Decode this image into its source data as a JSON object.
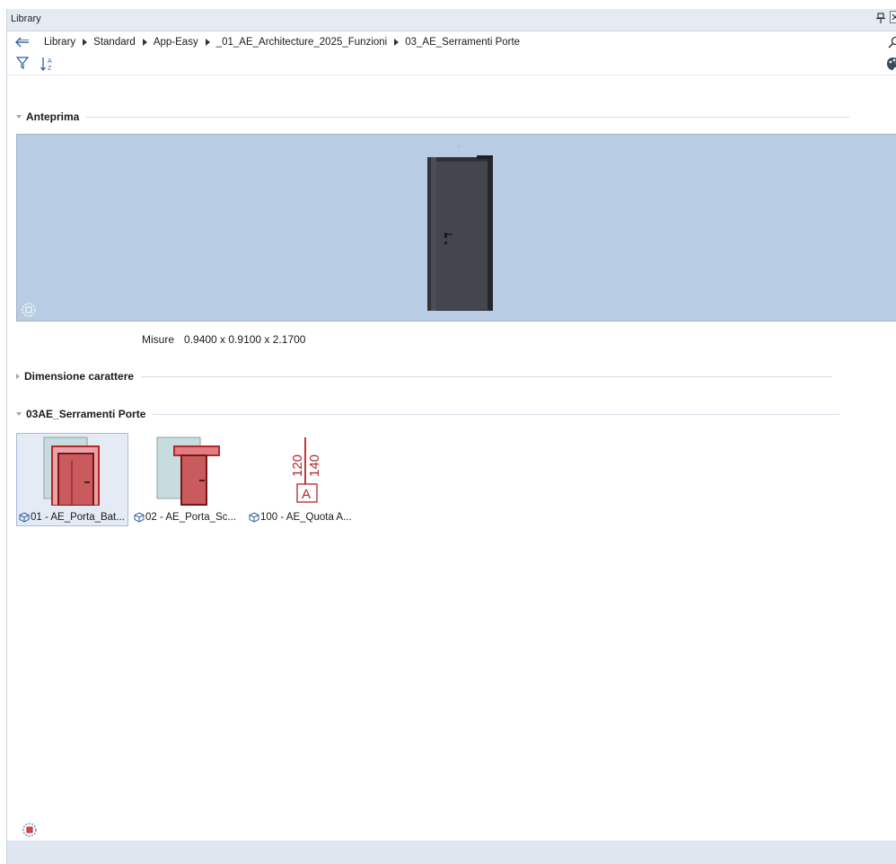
{
  "window": {
    "title": "Library"
  },
  "path": {
    "crumbs": [
      "Library",
      "Standard",
      "App-Easy",
      "_01_AE_Architecture_2025_Funzioni",
      "03_AE_Serramenti Porte"
    ]
  },
  "preview_section": {
    "label": "Anteprima"
  },
  "measure": {
    "label": "Misure",
    "value": "0.9400 x 0.9100 x 2.1700"
  },
  "font_section": {
    "label": "Dimensione carattere"
  },
  "folder_section": {
    "label": "03AE_Serramenti Porte"
  },
  "items": [
    {
      "label": "01 - AE_Porta_Bat...",
      "selected": true
    },
    {
      "label": "02 - AE_Porta_Sc...",
      "selected": false
    },
    {
      "label": "100 - AE_Quota A...",
      "selected": false
    }
  ],
  "quota_thumb": {
    "value_a": "120",
    "value_b": "140",
    "letter": "A"
  },
  "colors": {
    "titlebar": "#e6ebf2",
    "preview_bg": "#b8cde3",
    "door_dark": "#3c4046",
    "thumb_red": "#b5262b",
    "thumb_fill": "#c95b5e",
    "thumb_glass": "#c7dcdc",
    "selection": "#e4ebf4",
    "statusbar": "#dfe6ef"
  },
  "icons": [
    "back-arrow-icon",
    "chevron-right-icon",
    "search-icon",
    "filter-icon",
    "sort-az-icon",
    "palette-icon",
    "pin-icon",
    "close-icon",
    "viewcube-icon",
    "object-cube-icon"
  ]
}
